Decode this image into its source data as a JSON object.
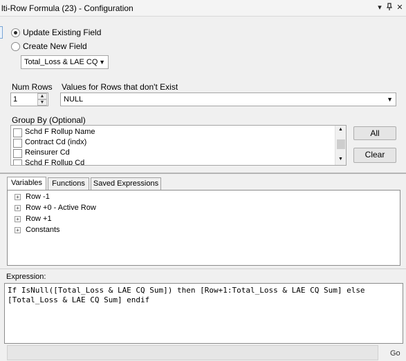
{
  "window": {
    "title": "lti-Row Formula (23) - Configuration",
    "btn_dropdown": "▾",
    "btn_pin": "📌",
    "btn_close": "✕"
  },
  "field_mode": {
    "option_update": "Update Existing Field",
    "option_create": "Create New  Field",
    "selected": "update",
    "field_select_value": "Total_Loss & LAE CQ"
  },
  "num_rows": {
    "label": "Num Rows",
    "value": "1"
  },
  "values_nonexist": {
    "label": "Values for Rows that don't Exist",
    "selected_value": "NULL"
  },
  "group_by": {
    "label": "Group By (Optional)",
    "items": [
      "Schd F Rollup Name",
      "Contract Cd  (indx)",
      "Reinsurer Cd",
      "Schd F Rollup Cd"
    ],
    "all_button": "All",
    "clear_button": "Clear"
  },
  "tabs": [
    "Variables",
    "Functions",
    "Saved Expressions"
  ],
  "tree": [
    "Row -1",
    "Row +0 - Active Row",
    "Row +1",
    "Constants"
  ],
  "expression": {
    "label": "Expression:",
    "text": "If IsNull([Total_Loss & LAE CQ Sum]) then [Row+1:Total_Loss & LAE CQ Sum] else\n[Total_Loss & LAE CQ Sum] endif"
  },
  "bottom": {
    "go_label": "Go"
  }
}
